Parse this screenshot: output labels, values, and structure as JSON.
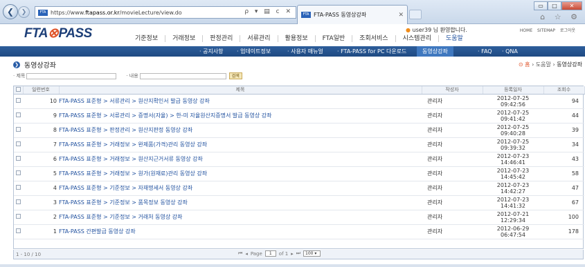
{
  "browser": {
    "url_prefix": "https://www.",
    "url_domain": "ftapass.or.kr",
    "url_path": "/movieLecture/view.do",
    "address_icons": "ρ ▾ ▤ c ✕",
    "tab_title": "FTA-PASS 동영상강좌",
    "tab_close": "✕",
    "favicon_text": "FTA",
    "back_glyph": "❮",
    "forward_glyph": "❯",
    "min_glyph": "▭",
    "max_glyph": "□",
    "close_glyph": "✕",
    "tools_glyphs": "⌂ ☆ ⚙"
  },
  "site": {
    "logo_text": "FTA",
    "logo_dot": "⊗",
    "logo_end": "PASS",
    "welcome_dot": "●",
    "welcome": "user39 님 환영합니다.",
    "util": [
      "HOME",
      "SITEMAP",
      "로그아웃"
    ],
    "gnb": [
      "기준정보",
      "거래정보",
      "판정관리",
      "서류관리",
      "활용정보",
      "FTA일반",
      "조회서비스",
      "시스템관리",
      "도움말"
    ]
  },
  "subnav": [
    "· 공지사항",
    "· 업데이트정보",
    "· 사용자 매뉴얼",
    "· FTA-PASS for PC 다운로드",
    "동영상강좌",
    "· FAQ",
    "· QNA"
  ],
  "page": {
    "title": "동영상강좌",
    "title_bullet": "❯",
    "crumb_home": "⊙ 홈",
    "crumb_sep1": " › 도움말 › ",
    "crumb_current": "동영상강좌"
  },
  "search": {
    "title_label": "· 제목",
    "content_label": "· 내용",
    "button": "검색"
  },
  "grid": {
    "headers": [
      "",
      "일련번호",
      "제목",
      "작성자",
      "등록일자",
      "조회수"
    ],
    "rows": [
      {
        "num": "10",
        "title": "FTA-PASS 표준형 > 서류관리 > 원산지확인서 발급 동영상 강좌",
        "author": "관리자",
        "date": "2012-07-25",
        "time": "09:42:56",
        "views": "94"
      },
      {
        "num": "9",
        "title": "FTA-PASS 표준형 > 서류관리 > 증명서(자율) > 한-미 자율원산지증명서 발급 동영상 강좌",
        "author": "관리자",
        "date": "2012-07-25",
        "time": "09:41:42",
        "views": "44"
      },
      {
        "num": "8",
        "title": "FTA-PASS 표준형 > 판정관리 > 원산지판정 동영상 강좌",
        "author": "관리자",
        "date": "2012-07-25",
        "time": "09:40:28",
        "views": "39"
      },
      {
        "num": "7",
        "title": "FTA-PASS 표준형 > 거래정보 > 완제품(가격)관리 동영상 강좌",
        "author": "관리자",
        "date": "2012-07-25",
        "time": "09:39:32",
        "views": "34"
      },
      {
        "num": "6",
        "title": "FTA-PASS 표준형 > 거래정보 > 원산지근거서류 동영상 강좌",
        "author": "관리자",
        "date": "2012-07-23",
        "time": "14:46:41",
        "views": "43"
      },
      {
        "num": "5",
        "title": "FTA-PASS 표준형 > 거래정보 > 원가(원재료)관리 동영상 강좌",
        "author": "관리자",
        "date": "2012-07-23",
        "time": "14:45:42",
        "views": "58"
      },
      {
        "num": "4",
        "title": "FTA-PASS 표준형 > 기준정보 > 자재명세서 동영상 강좌",
        "author": "관리자",
        "date": "2012-07-23",
        "time": "14:42:27",
        "views": "47"
      },
      {
        "num": "3",
        "title": "FTA-PASS 표준형 > 기준정보 > 품목정보 동영상 강좌",
        "author": "관리자",
        "date": "2012-07-23",
        "time": "14:41:32",
        "views": "67"
      },
      {
        "num": "2",
        "title": "FTA-PASS 표준형 > 기준정보 > 거래처 동영상 강좌",
        "author": "관리자",
        "date": "2012-07-21",
        "time": "12:29:34",
        "views": "100"
      },
      {
        "num": "1",
        "title": "FTA-PASS 간편발급 동영상 강좌",
        "author": "관리자",
        "date": "2012-06-29",
        "time": "06:47:54",
        "views": "178"
      }
    ]
  },
  "pager": {
    "count": "1 - 10 / 10",
    "first": "⏮",
    "prev": "◂",
    "page_label": "Page",
    "page_value": "1",
    "of_label": "of 1",
    "next": "▸",
    "last": "⏭",
    "size_value": "100 ▾"
  }
}
